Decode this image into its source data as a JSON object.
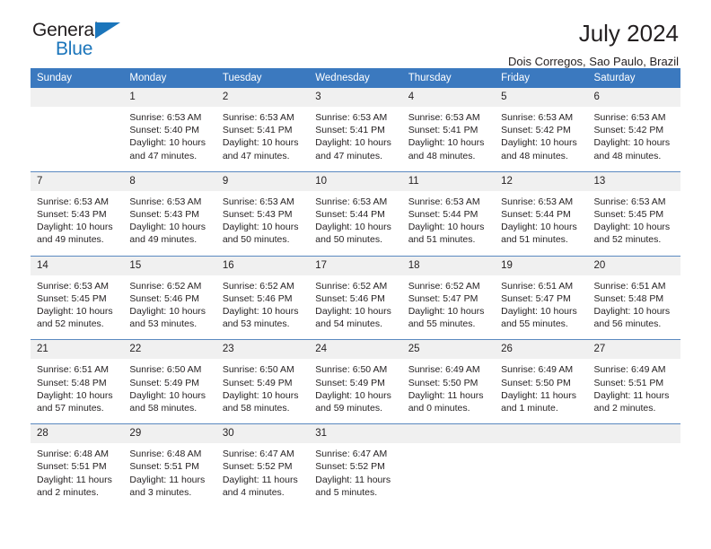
{
  "brand": {
    "name_top": "General",
    "name_bottom": "Blue",
    "triangle_color": "#1b75bb",
    "text_color": "#231f20"
  },
  "header": {
    "title": "July 2024",
    "subtitle": "Dois Corregos, Sao Paulo, Brazil"
  },
  "theme": {
    "header_row_bg": "#3b79bf",
    "header_row_text": "#ffffff",
    "daynum_bg": "#f0f0f0",
    "cell_border": "#5b89c0",
    "text": "#231f20"
  },
  "weekdays": [
    "Sunday",
    "Monday",
    "Tuesday",
    "Wednesday",
    "Thursday",
    "Friday",
    "Saturday"
  ],
  "weeks": [
    [
      {
        "day": "",
        "blank": true,
        "sunrise": "",
        "sunset": "",
        "daylight1": "",
        "daylight2": ""
      },
      {
        "day": "1",
        "sunrise": "Sunrise: 6:53 AM",
        "sunset": "Sunset: 5:40 PM",
        "daylight1": "Daylight: 10 hours",
        "daylight2": "and 47 minutes."
      },
      {
        "day": "2",
        "sunrise": "Sunrise: 6:53 AM",
        "sunset": "Sunset: 5:41 PM",
        "daylight1": "Daylight: 10 hours",
        "daylight2": "and 47 minutes."
      },
      {
        "day": "3",
        "sunrise": "Sunrise: 6:53 AM",
        "sunset": "Sunset: 5:41 PM",
        "daylight1": "Daylight: 10 hours",
        "daylight2": "and 47 minutes."
      },
      {
        "day": "4",
        "sunrise": "Sunrise: 6:53 AM",
        "sunset": "Sunset: 5:41 PM",
        "daylight1": "Daylight: 10 hours",
        "daylight2": "and 48 minutes."
      },
      {
        "day": "5",
        "sunrise": "Sunrise: 6:53 AM",
        "sunset": "Sunset: 5:42 PM",
        "daylight1": "Daylight: 10 hours",
        "daylight2": "and 48 minutes."
      },
      {
        "day": "6",
        "sunrise": "Sunrise: 6:53 AM",
        "sunset": "Sunset: 5:42 PM",
        "daylight1": "Daylight: 10 hours",
        "daylight2": "and 48 minutes."
      }
    ],
    [
      {
        "day": "7",
        "sunrise": "Sunrise: 6:53 AM",
        "sunset": "Sunset: 5:43 PM",
        "daylight1": "Daylight: 10 hours",
        "daylight2": "and 49 minutes."
      },
      {
        "day": "8",
        "sunrise": "Sunrise: 6:53 AM",
        "sunset": "Sunset: 5:43 PM",
        "daylight1": "Daylight: 10 hours",
        "daylight2": "and 49 minutes."
      },
      {
        "day": "9",
        "sunrise": "Sunrise: 6:53 AM",
        "sunset": "Sunset: 5:43 PM",
        "daylight1": "Daylight: 10 hours",
        "daylight2": "and 50 minutes."
      },
      {
        "day": "10",
        "sunrise": "Sunrise: 6:53 AM",
        "sunset": "Sunset: 5:44 PM",
        "daylight1": "Daylight: 10 hours",
        "daylight2": "and 50 minutes."
      },
      {
        "day": "11",
        "sunrise": "Sunrise: 6:53 AM",
        "sunset": "Sunset: 5:44 PM",
        "daylight1": "Daylight: 10 hours",
        "daylight2": "and 51 minutes."
      },
      {
        "day": "12",
        "sunrise": "Sunrise: 6:53 AM",
        "sunset": "Sunset: 5:44 PM",
        "daylight1": "Daylight: 10 hours",
        "daylight2": "and 51 minutes."
      },
      {
        "day": "13",
        "sunrise": "Sunrise: 6:53 AM",
        "sunset": "Sunset: 5:45 PM",
        "daylight1": "Daylight: 10 hours",
        "daylight2": "and 52 minutes."
      }
    ],
    [
      {
        "day": "14",
        "sunrise": "Sunrise: 6:53 AM",
        "sunset": "Sunset: 5:45 PM",
        "daylight1": "Daylight: 10 hours",
        "daylight2": "and 52 minutes."
      },
      {
        "day": "15",
        "sunrise": "Sunrise: 6:52 AM",
        "sunset": "Sunset: 5:46 PM",
        "daylight1": "Daylight: 10 hours",
        "daylight2": "and 53 minutes."
      },
      {
        "day": "16",
        "sunrise": "Sunrise: 6:52 AM",
        "sunset": "Sunset: 5:46 PM",
        "daylight1": "Daylight: 10 hours",
        "daylight2": "and 53 minutes."
      },
      {
        "day": "17",
        "sunrise": "Sunrise: 6:52 AM",
        "sunset": "Sunset: 5:46 PM",
        "daylight1": "Daylight: 10 hours",
        "daylight2": "and 54 minutes."
      },
      {
        "day": "18",
        "sunrise": "Sunrise: 6:52 AM",
        "sunset": "Sunset: 5:47 PM",
        "daylight1": "Daylight: 10 hours",
        "daylight2": "and 55 minutes."
      },
      {
        "day": "19",
        "sunrise": "Sunrise: 6:51 AM",
        "sunset": "Sunset: 5:47 PM",
        "daylight1": "Daylight: 10 hours",
        "daylight2": "and 55 minutes."
      },
      {
        "day": "20",
        "sunrise": "Sunrise: 6:51 AM",
        "sunset": "Sunset: 5:48 PM",
        "daylight1": "Daylight: 10 hours",
        "daylight2": "and 56 minutes."
      }
    ],
    [
      {
        "day": "21",
        "sunrise": "Sunrise: 6:51 AM",
        "sunset": "Sunset: 5:48 PM",
        "daylight1": "Daylight: 10 hours",
        "daylight2": "and 57 minutes."
      },
      {
        "day": "22",
        "sunrise": "Sunrise: 6:50 AM",
        "sunset": "Sunset: 5:49 PM",
        "daylight1": "Daylight: 10 hours",
        "daylight2": "and 58 minutes."
      },
      {
        "day": "23",
        "sunrise": "Sunrise: 6:50 AM",
        "sunset": "Sunset: 5:49 PM",
        "daylight1": "Daylight: 10 hours",
        "daylight2": "and 58 minutes."
      },
      {
        "day": "24",
        "sunrise": "Sunrise: 6:50 AM",
        "sunset": "Sunset: 5:49 PM",
        "daylight1": "Daylight: 10 hours",
        "daylight2": "and 59 minutes."
      },
      {
        "day": "25",
        "sunrise": "Sunrise: 6:49 AM",
        "sunset": "Sunset: 5:50 PM",
        "daylight1": "Daylight: 11 hours",
        "daylight2": "and 0 minutes."
      },
      {
        "day": "26",
        "sunrise": "Sunrise: 6:49 AM",
        "sunset": "Sunset: 5:50 PM",
        "daylight1": "Daylight: 11 hours",
        "daylight2": "and 1 minute."
      },
      {
        "day": "27",
        "sunrise": "Sunrise: 6:49 AM",
        "sunset": "Sunset: 5:51 PM",
        "daylight1": "Daylight: 11 hours",
        "daylight2": "and 2 minutes."
      }
    ],
    [
      {
        "day": "28",
        "sunrise": "Sunrise: 6:48 AM",
        "sunset": "Sunset: 5:51 PM",
        "daylight1": "Daylight: 11 hours",
        "daylight2": "and 2 minutes."
      },
      {
        "day": "29",
        "sunrise": "Sunrise: 6:48 AM",
        "sunset": "Sunset: 5:51 PM",
        "daylight1": "Daylight: 11 hours",
        "daylight2": "and 3 minutes."
      },
      {
        "day": "30",
        "sunrise": "Sunrise: 6:47 AM",
        "sunset": "Sunset: 5:52 PM",
        "daylight1": "Daylight: 11 hours",
        "daylight2": "and 4 minutes."
      },
      {
        "day": "31",
        "sunrise": "Sunrise: 6:47 AM",
        "sunset": "Sunset: 5:52 PM",
        "daylight1": "Daylight: 11 hours",
        "daylight2": "and 5 minutes."
      },
      {
        "day": "",
        "blank": true,
        "sunrise": "",
        "sunset": "",
        "daylight1": "",
        "daylight2": ""
      },
      {
        "day": "",
        "blank": true,
        "sunrise": "",
        "sunset": "",
        "daylight1": "",
        "daylight2": ""
      },
      {
        "day": "",
        "blank": true,
        "sunrise": "",
        "sunset": "",
        "daylight1": "",
        "daylight2": ""
      }
    ]
  ]
}
